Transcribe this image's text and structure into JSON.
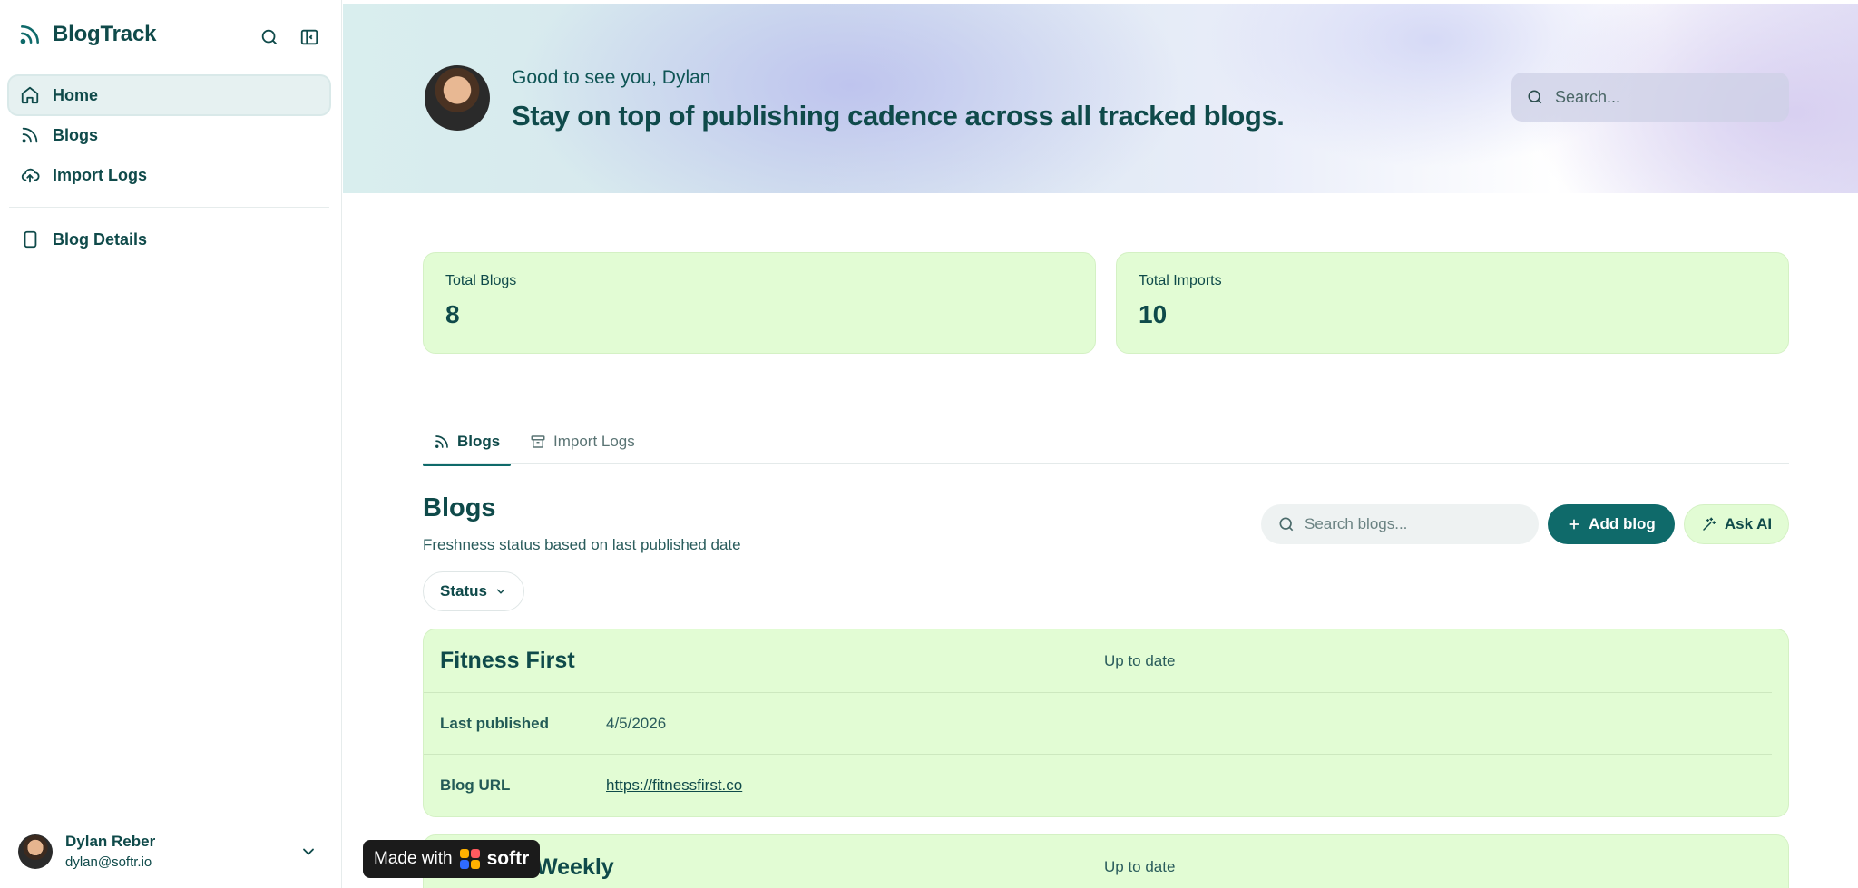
{
  "app": {
    "name": "BlogTrack"
  },
  "sidebar": {
    "items": [
      {
        "label": "Home"
      },
      {
        "label": "Blogs"
      },
      {
        "label": "Import Logs"
      },
      {
        "label": "Blog Details"
      }
    ],
    "user": {
      "name": "Dylan Reber",
      "email": "dylan@softr.io"
    }
  },
  "hero": {
    "greeting": "Good to see you, Dylan",
    "title": "Stay on top of publishing cadence across all tracked blogs.",
    "search_placeholder": "Search..."
  },
  "stats": [
    {
      "label": "Total Blogs",
      "value": "8"
    },
    {
      "label": "Total Imports",
      "value": "10"
    }
  ],
  "tabs": [
    {
      "label": "Blogs"
    },
    {
      "label": "Import Logs"
    }
  ],
  "blogs_section": {
    "title": "Blogs",
    "subtitle": "Freshness status based on last published date",
    "search_placeholder": "Search blogs...",
    "add_label": "Add blog",
    "ai_label": "Ask AI",
    "filter_label": "Status"
  },
  "cards": [
    {
      "name": "Fitness First",
      "status": "Up to date",
      "last_published_label": "Last published",
      "last_published": "4/5/2026",
      "url_label": "Blog URL",
      "url": "https://fitnessfirst.co"
    },
    {
      "name": "Weekly",
      "status": "Up to date"
    }
  ],
  "badge": {
    "prefix": "Made with",
    "brand": "softr"
  },
  "colors": {
    "primary": "#0f6a6a",
    "text": "#0f4a4a",
    "card_bg": "#e2fcd4"
  }
}
